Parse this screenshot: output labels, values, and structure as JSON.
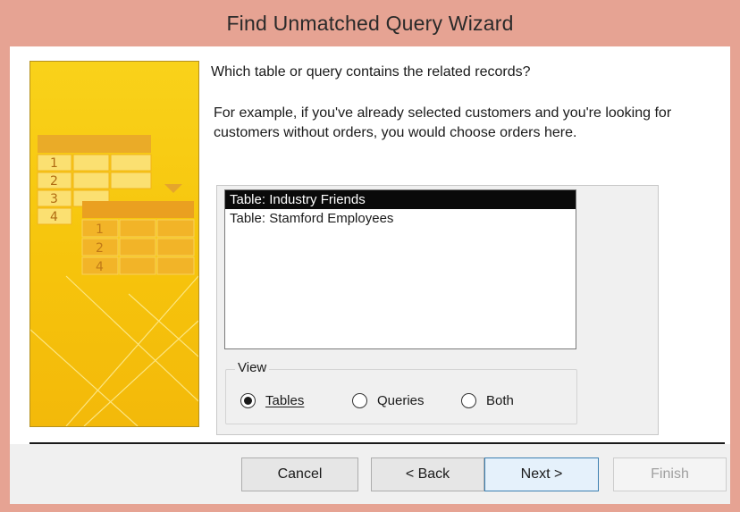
{
  "window": {
    "title": "Find Unmatched Query Wizard"
  },
  "prompt": {
    "question": "Which table or query contains the related records?",
    "example_line1": "For example, if you've already selected customers and you're looking for",
    "example_line2": "customers without orders, you would choose orders here."
  },
  "list": {
    "items": [
      {
        "label": "Table: Industry Friends",
        "selected": true
      },
      {
        "label": "Table: Stamford Employees",
        "selected": false
      }
    ]
  },
  "view": {
    "legend": "View",
    "options": [
      {
        "label": "Tables",
        "checked": true
      },
      {
        "label": "Queries",
        "checked": false
      },
      {
        "label": "Both",
        "checked": false
      }
    ]
  },
  "illustration": {
    "grid_numbers_back": [
      "1",
      "2",
      "3",
      "4"
    ],
    "grid_numbers_front": [
      "1",
      "2",
      "4"
    ]
  },
  "buttons": {
    "cancel": "Cancel",
    "back": "< Back",
    "next": "Next >",
    "finish": "Finish"
  },
  "colors": {
    "title_bar": "#e6a393",
    "illustration_yellow": "#f7c70d",
    "selection": "#0a0a0a"
  }
}
